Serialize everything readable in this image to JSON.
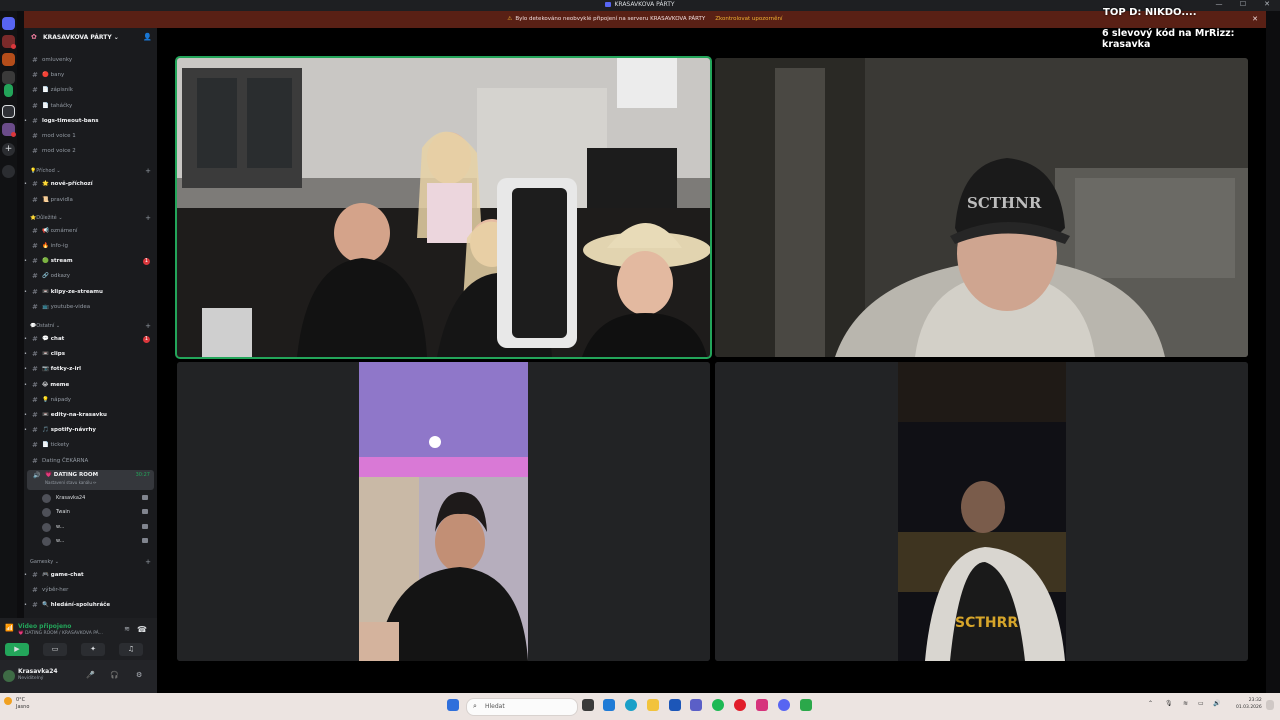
{
  "window": {
    "title": "KRASAVKOVA PÁRTY",
    "controls": [
      "—",
      "☐",
      "✕"
    ]
  },
  "banner": {
    "message": "Bylo detekováno neobvyklé připojení na serveru KRASAVKOVA PÁRTY",
    "action": "Zkontrolovat upozornění"
  },
  "server": {
    "name": "KRASAVKOVA PÁRTY ⌄"
  },
  "sidebar": {
    "channels_top": [
      {
        "label": "omluvenky",
        "bold": false
      },
      {
        "label": "🔴 bany",
        "bold": false
      },
      {
        "label": "📄 zápisník",
        "bold": false
      },
      {
        "label": "📄 taháčky",
        "bold": false
      },
      {
        "label": "logs-timeout-bans",
        "bold": true
      },
      {
        "label": "mod voice 1",
        "bold": false
      },
      {
        "label": "mod voice 2",
        "bold": false
      }
    ],
    "category_prichod": "💡Příchod ⌄",
    "channels_prichod": [
      {
        "label": "🌟 nově-příchozí",
        "bold": true
      },
      {
        "label": "📜 pravidla",
        "bold": false
      }
    ],
    "category_dulezite": "⭐Důležité ⌄",
    "channels_dulezite": [
      {
        "label": "📢 oznámení",
        "bold": false
      },
      {
        "label": "🔥 info-ig",
        "bold": false
      },
      {
        "label": "🟢 stream",
        "bold": true,
        "unread": "1"
      },
      {
        "label": "🔗 odkazy",
        "bold": false
      },
      {
        "label": "📼 klipy-ze-streamu",
        "bold": true
      },
      {
        "label": "📺 youtube-videa",
        "bold": false
      }
    ],
    "category_ostatni": "💬Ostatní ⌄",
    "channels_ostatni": [
      {
        "label": "💬 chat",
        "bold": true,
        "unread": "1"
      },
      {
        "label": "📼 clips",
        "bold": true
      },
      {
        "label": "📷 fotky-z-irl",
        "bold": true
      },
      {
        "label": "😂 meme",
        "bold": true
      },
      {
        "label": "💡 nápady",
        "bold": false
      },
      {
        "label": "📼 edity-na-krasavku",
        "bold": true
      },
      {
        "label": "🎵 spotify-návrhy",
        "bold": true
      },
      {
        "label": "📄 tickety",
        "bold": false
      },
      {
        "label": "Dating ČEKÁRNA",
        "bold": false
      }
    ],
    "active_voice": {
      "label": "💗 DATING ROOM",
      "status": "Nastavení stavu kanálu ✏",
      "timer": "30:27"
    },
    "voice_users": [
      "Krasavka24",
      "Twain",
      "w...",
      "w..."
    ],
    "category_gamesky": "Gamesky ⌄",
    "channels_gamesky": [
      {
        "label": "🎮 game-chat",
        "bold": true
      },
      {
        "label": "výběr-her",
        "bold": false
      },
      {
        "label": "🔍 hledání-spoluhráče",
        "bold": true
      }
    ]
  },
  "voice_panel": {
    "connected": "Video připojeno",
    "location": "💗 DATING ROOM / KRASAVKOVA PÁ..."
  },
  "user_panel": {
    "username": "Krasavka24",
    "status": "Neviditelný"
  },
  "overlay": {
    "line1": "TOP D: NIKDO....",
    "line2": "6 slevový kód na MrRizz: krasavka"
  },
  "taskbar": {
    "weather_temp": "0°C",
    "weather_desc": "Jasno",
    "search_placeholder": "Hledat",
    "time": "23:32",
    "date": "01.03.2026"
  },
  "colors": {
    "accent_green": "#23a55a",
    "banner_bg": "#592015",
    "unread_red": "#da373c",
    "sidebar_bg": "#1a1b1e"
  }
}
